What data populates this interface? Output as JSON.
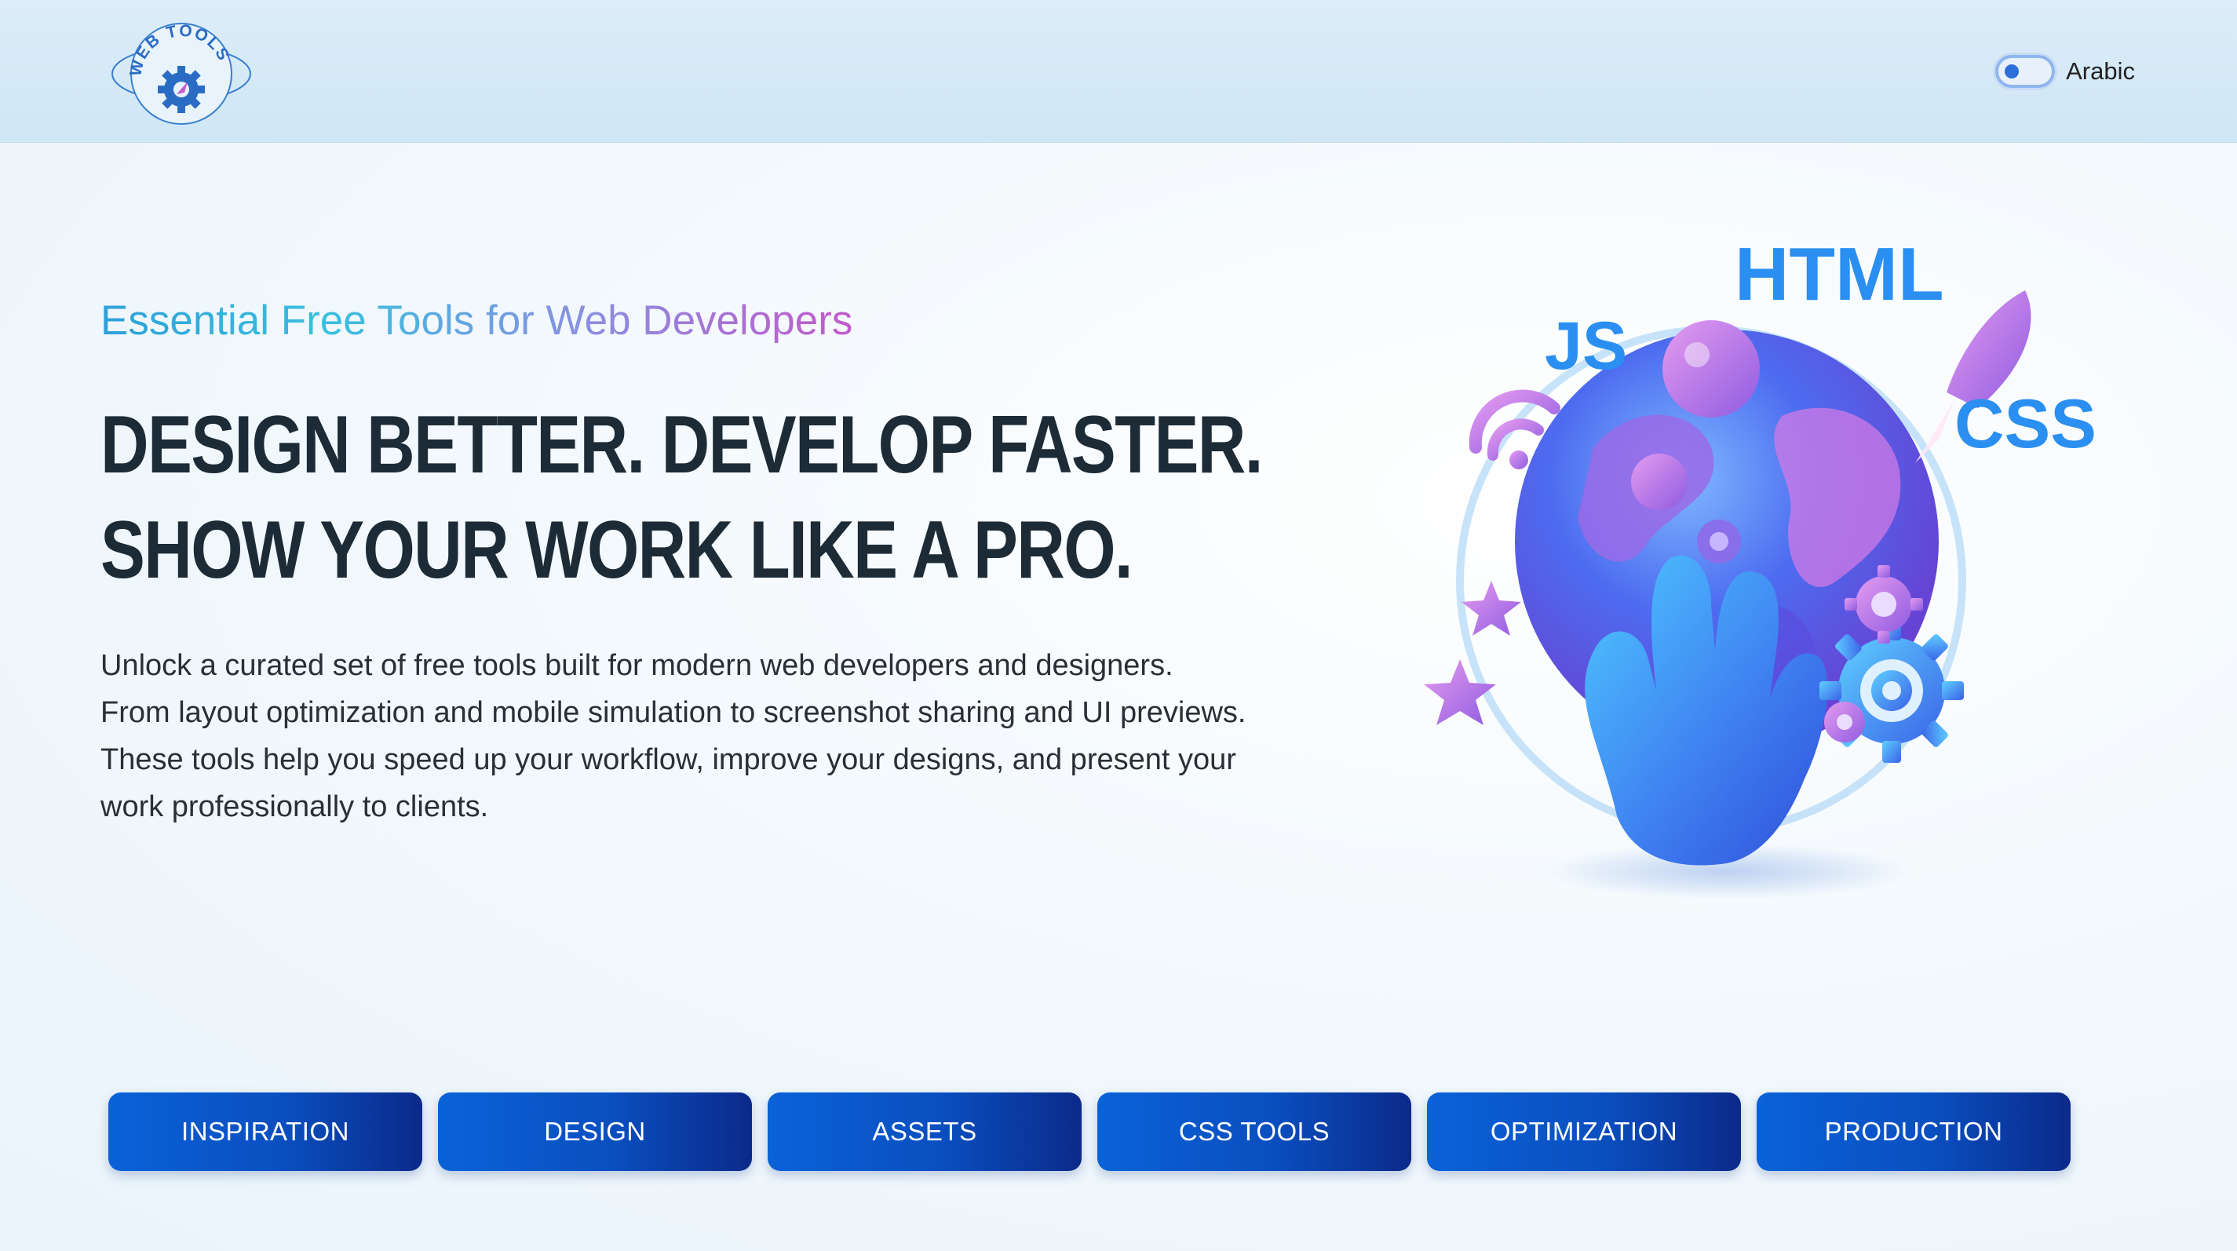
{
  "header": {
    "logo_text": "WEB TOOLS",
    "language_toggle_label": "Arabic"
  },
  "hero": {
    "subtitle": "Essential Free Tools for Web Developers",
    "headline_line1": "DESIGN BETTER. DEVELOP FASTER.",
    "headline_line2": "SHOW YOUR WORK LIKE A PRO.",
    "description_line1": "Unlock a curated set of free tools built for modern web developers and designers.",
    "description_line2": "From layout optimization and mobile simulation to screenshot sharing and UI previews.",
    "description_line3": "These tools help you speed up your workflow, improve your designs, and present your",
    "description_line4": "work professionally to clients.",
    "illustration_labels": [
      "HTML",
      "JS",
      "CSS"
    ]
  },
  "nav": {
    "items": [
      {
        "label": "INSPIRATION"
      },
      {
        "label": "DESIGN"
      },
      {
        "label": "ASSETS"
      },
      {
        "label": "CSS TOOLS"
      },
      {
        "label": "OPTIMIZATION"
      },
      {
        "label": "PRODUCTION"
      }
    ]
  },
  "colors": {
    "header_bg": "#d4e9f7",
    "button_gradient_start": "#0a62d8",
    "button_gradient_end": "#0b2a8a",
    "headline": "#1d2b36",
    "illustration_text": "#2a8ff0"
  }
}
